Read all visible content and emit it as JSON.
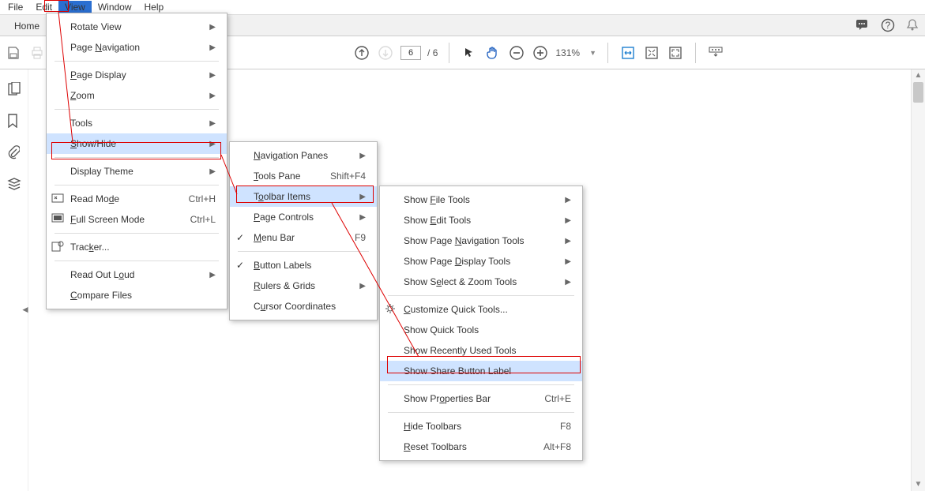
{
  "menubar": {
    "file": "File",
    "edit": "Edit",
    "view": "View",
    "window": "Window",
    "help": "Help"
  },
  "tabbar": {
    "home": "Home"
  },
  "toolbar": {
    "page_current": "6",
    "page_total": "/  6",
    "zoom": "131%"
  },
  "view_menu": {
    "rotate": "Rotate View",
    "pagenav": "Page Navigation",
    "pagedisp": "Page Display",
    "zoom": "Zoom",
    "tools": "Tools",
    "showhide": "Show/Hide",
    "theme": "Display Theme",
    "readmode": "Read Mode",
    "readmode_sc": "Ctrl+H",
    "fullscreen": "Full Screen Mode",
    "fullscreen_sc": "Ctrl+L",
    "tracker": "Tracker...",
    "readloud": "Read Out Loud",
    "compare": "Compare Files"
  },
  "showhide_menu": {
    "navpanes": "Navigation Panes",
    "toolspane": "Tools Pane",
    "toolspane_sc": "Shift+F4",
    "toolbar": "Toolbar Items",
    "pagectrl": "Page Controls",
    "menubar": "Menu Bar",
    "menubar_sc": "F9",
    "btnlabels": "Button Labels",
    "rulers": "Rulers & Grids",
    "cursor": "Cursor Coordinates"
  },
  "toolbar_menu": {
    "file": "Show File Tools",
    "edit": "Show Edit Tools",
    "pagenav": "Show Page Navigation Tools",
    "pagedisp": "Show Page Display Tools",
    "select": "Show Select & Zoom Tools",
    "customize": "Customize Quick Tools...",
    "quick": "Show Quick Tools",
    "recent": "Show Recently Used Tools",
    "share": "Show Share Button Label",
    "props": "Show Properties Bar",
    "props_sc": "Ctrl+E",
    "hide": "Hide Toolbars",
    "hide_sc": "F8",
    "reset": "Reset Toolbars",
    "reset_sc": "Alt+F8"
  }
}
